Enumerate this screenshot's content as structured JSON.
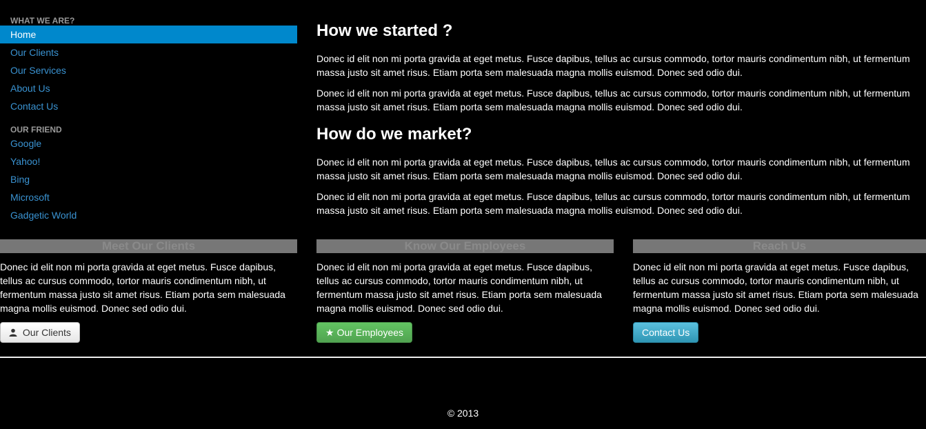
{
  "sidebar": {
    "header1": "WHAT WE ARE?",
    "items1": [
      {
        "label": "Home"
      },
      {
        "label": "Our Clients"
      },
      {
        "label": "Our Services"
      },
      {
        "label": "About Us"
      },
      {
        "label": "Contact Us"
      }
    ],
    "header2": "OUR FRIEND",
    "items2": [
      {
        "label": "Google"
      },
      {
        "label": "Yahoo!"
      },
      {
        "label": "Bing"
      },
      {
        "label": "Microsoft"
      },
      {
        "label": "Gadgetic World"
      }
    ]
  },
  "main": {
    "heading1": "How we started ?",
    "heading2": "How do we market?",
    "paragraph": "Donec id elit non mi porta gravida at eget metus. Fusce dapibus, tellus ac cursus commodo, tortor mauris condimentum nibh, ut fermentum massa justo sit amet risus. Etiam porta sem malesuada magna mollis euismod. Donec sed odio dui."
  },
  "columns": [
    {
      "title": "Meet Our Clients",
      "text": "Donec id elit non mi porta gravida at eget metus. Fusce dapibus, tellus ac cursus commodo, tortor mauris condimentum nibh, ut fermentum massa justo sit amet risus. Etiam porta sem malesuada magna mollis euismod. Donec sed odio dui.",
      "button": "Our Clients",
      "icon": "user-icon"
    },
    {
      "title": "Know Our Employees",
      "text": "Donec id elit non mi porta gravida at eget metus. Fusce dapibus, tellus ac cursus commodo, tortor mauris condimentum nibh, ut fermentum massa justo sit amet risus. Etiam porta sem malesuada magna mollis euismod. Donec sed odio dui.",
      "button": "Our Employees",
      "icon": "star-icon"
    },
    {
      "title": "Reach Us",
      "text": "Donec id elit non mi porta gravida at eget metus. Fusce dapibus, tellus ac cursus commodo, tortor mauris condimentum nibh, ut fermentum massa justo sit amet risus. Etiam porta sem malesuada magna mollis euismod. Donec sed odio dui.",
      "button": "Contact Us"
    }
  ],
  "footer": {
    "copyright": "© 2013"
  },
  "colors": {
    "accent": "#0088cc",
    "link": "#3a93d2",
    "success": "#5bb75b",
    "info": "#49afcd"
  }
}
